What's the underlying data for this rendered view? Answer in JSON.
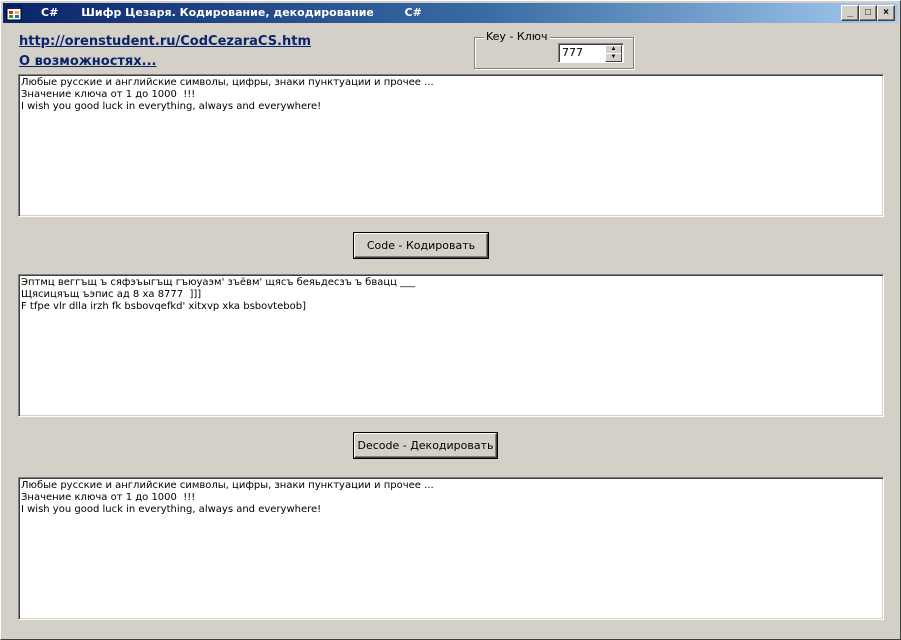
{
  "window": {
    "title": "C#      Шифр Цезаря. Кодирование, декодирование        C#",
    "buttons": {
      "minimize": "_",
      "maximize": "□",
      "close": "×"
    }
  },
  "links": {
    "url": "http://orenstudent.ru/CodCezaraCS.htm",
    "about": "О возможностях..."
  },
  "key": {
    "label": "Key - Ключ",
    "value": "777"
  },
  "input_text": {
    "lines": [
      "Любые русские и английские символы, цифры, знаки пунктуации и прочее ...",
      "Значение ключа от 1 до 1000  !!!",
      "I wish you good luck in everything, always and everywhere!"
    ]
  },
  "code_button": "Code - Кодировать",
  "encoded_text": {
    "lines": [
      "Эптмц веггъщ ъ сяфэъыгъщ гъюуаэм' зъёвм' щясъ беяьдесзъ ъ бвацц ___",
      "Щясицяъщ ъэпис ад 8 ха 8777  ]]]",
      "F tfpe vlr dlla irzh fk bsbovqefkd' xitxvp xka bsbovtebob]"
    ]
  },
  "decode_button": "Decode - Декодировать",
  "decoded_text": {
    "lines": [
      "Любые русские и английские символы, цифры, знаки пунктуации и прочее ...",
      "Значение ключа от 1 до 1000  !!!",
      "I wish you good luck in everything, always and everywhere!"
    ]
  }
}
